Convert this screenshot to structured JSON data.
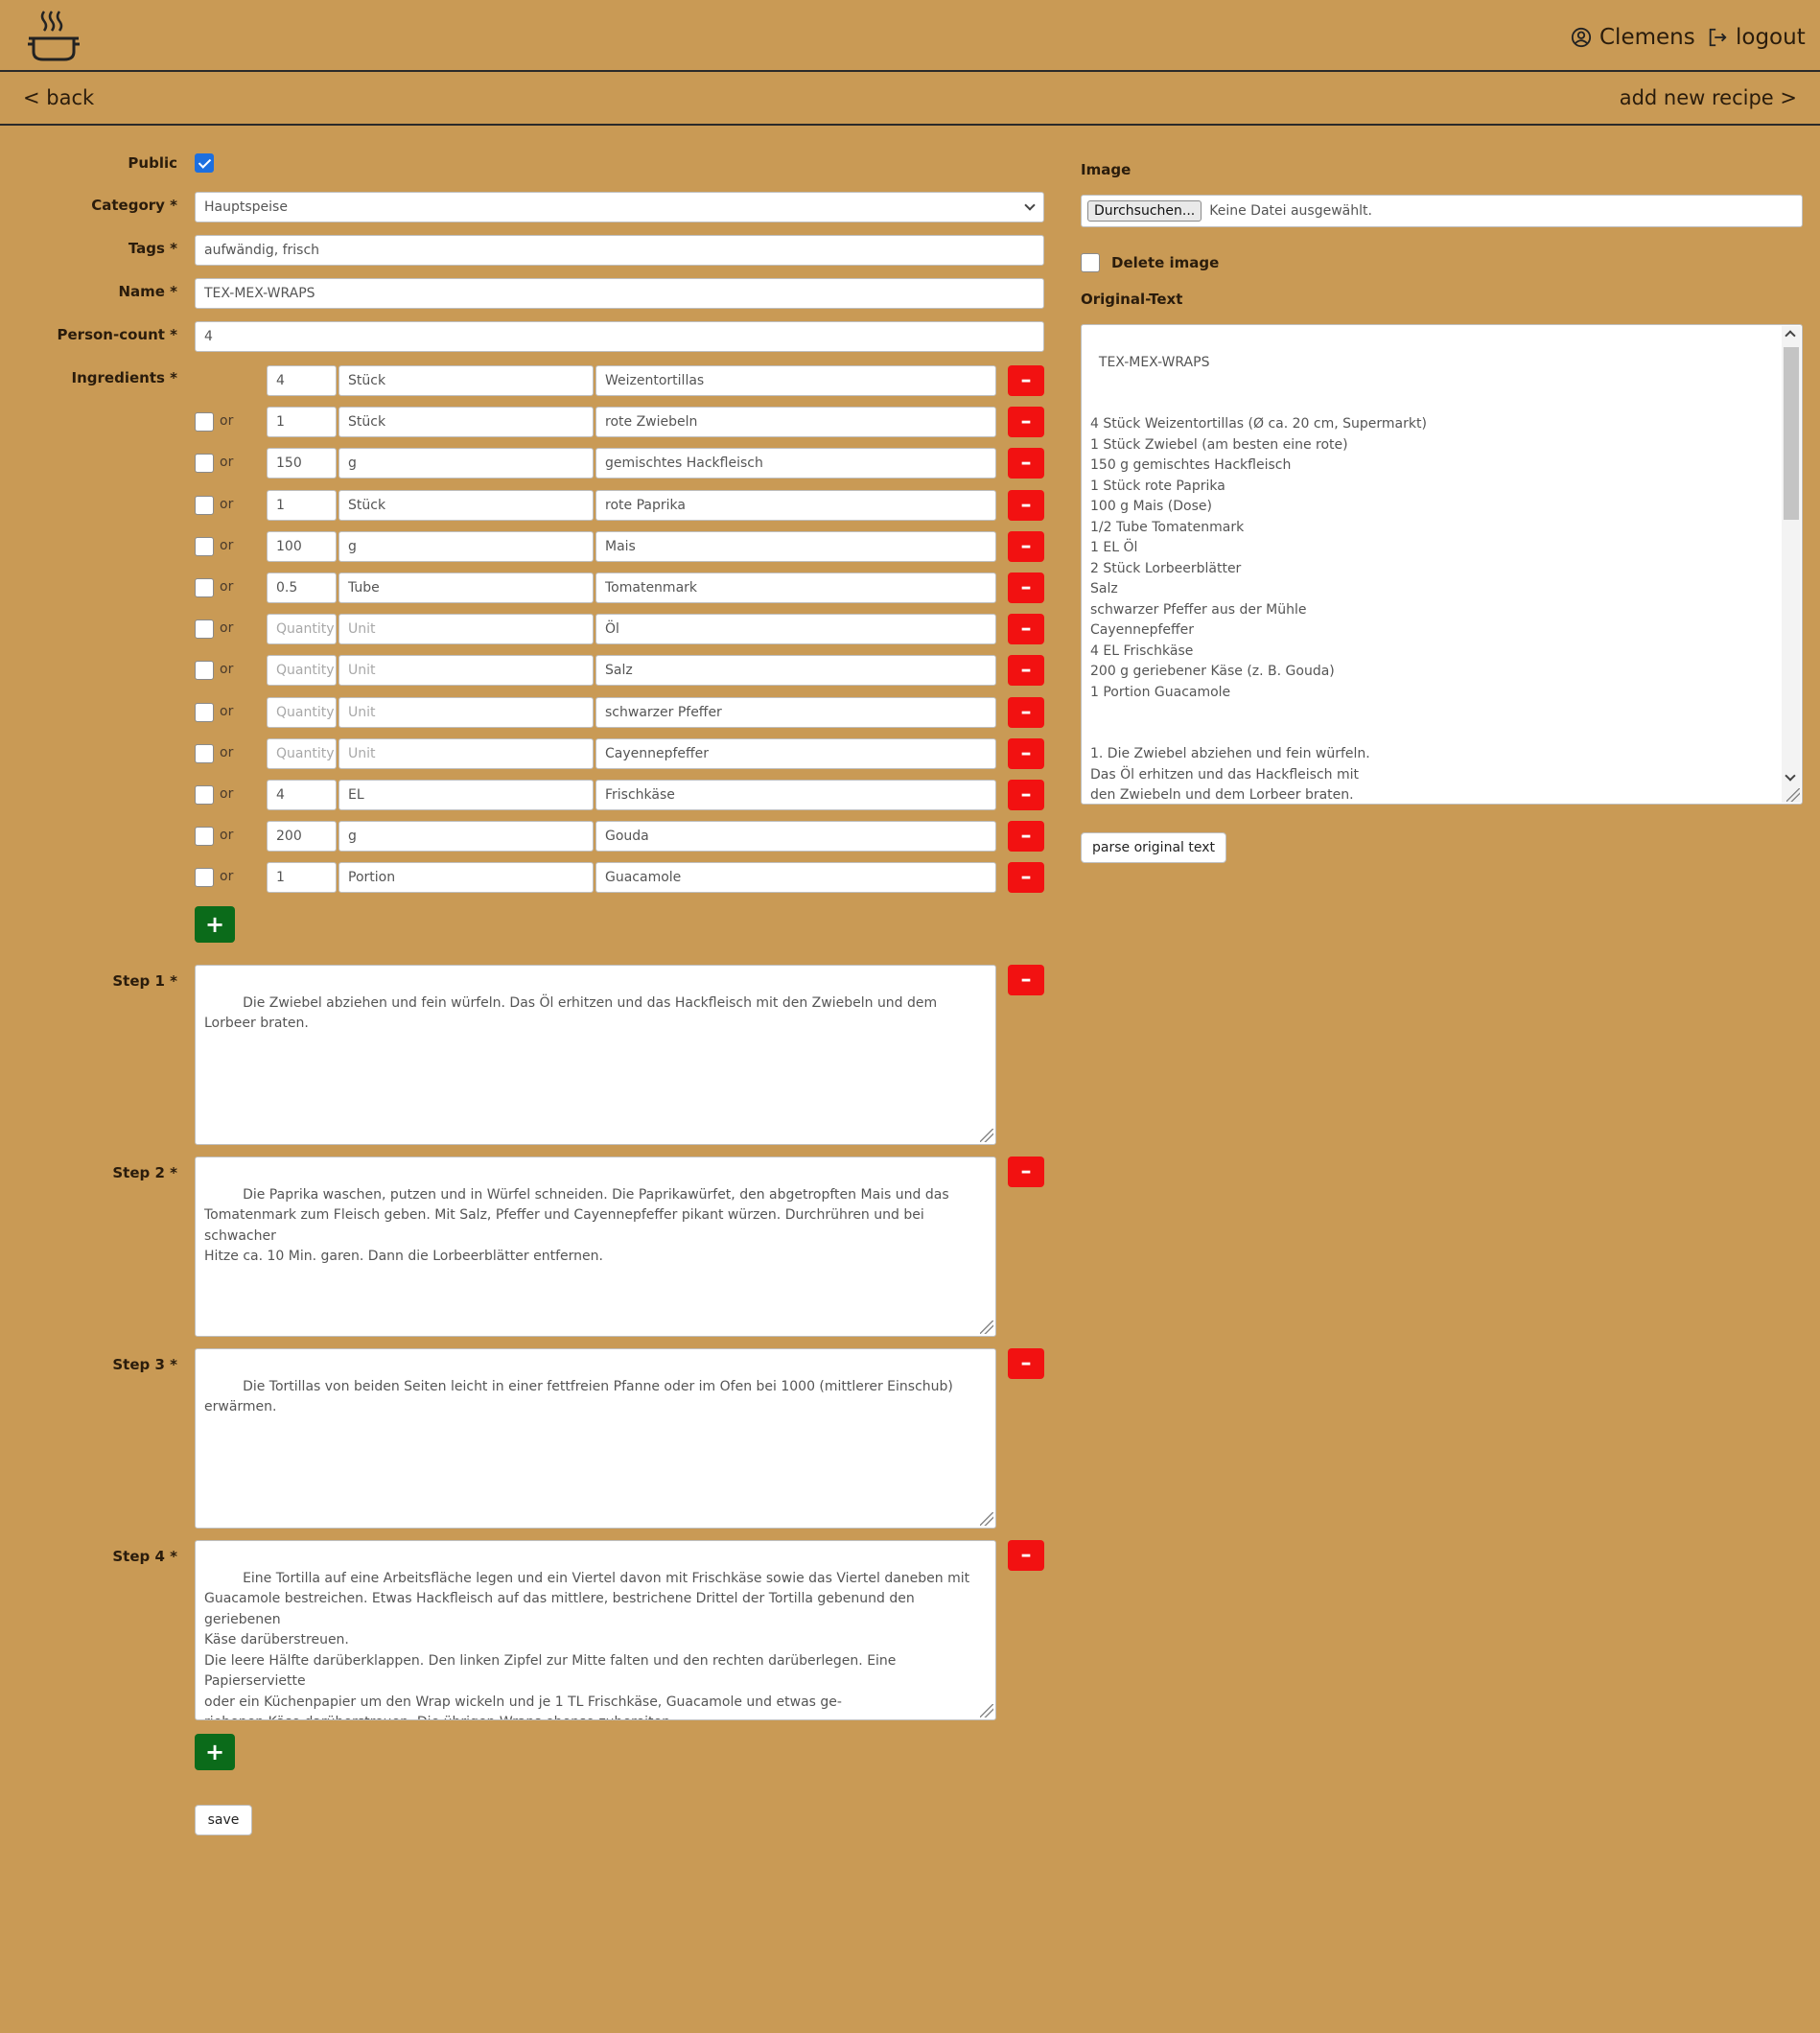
{
  "header": {
    "logo_icon": "cooking-pot-icon",
    "user_name": "Clemens",
    "logout_label": "logout"
  },
  "nav": {
    "back_label": "< back",
    "add_label": "add new recipe >"
  },
  "form": {
    "public_label": "Public",
    "public_checked": true,
    "category_label": "Category *",
    "category_value": "Hauptspeise",
    "tags_label": "Tags *",
    "tags_value": "aufwändig, frisch",
    "name_label": "Name *",
    "name_value": "TEX-MEX-WRAPS",
    "person_count_label": "Person-count *",
    "person_count_value": "4",
    "ingredients_label": "Ingredients *",
    "or_label": "or",
    "quantity_placeholder": "Quantity",
    "unit_placeholder": "Unit",
    "ingredients": [
      {
        "quantity": "4",
        "unit": "Stück",
        "name": "Weizentortillas"
      },
      {
        "quantity": "1",
        "unit": "Stück",
        "name": "rote Zwiebeln"
      },
      {
        "quantity": "150",
        "unit": "g",
        "name": "gemischtes Hackfleisch"
      },
      {
        "quantity": "1",
        "unit": "Stück",
        "name": "rote Paprika"
      },
      {
        "quantity": "100",
        "unit": "g",
        "name": "Mais"
      },
      {
        "quantity": "0.5",
        "unit": "Tube",
        "name": "Tomatenmark"
      },
      {
        "quantity": "",
        "unit": "",
        "name": "Öl"
      },
      {
        "quantity": "",
        "unit": "",
        "name": "Salz"
      },
      {
        "quantity": "",
        "unit": "",
        "name": "schwarzer Pfeffer"
      },
      {
        "quantity": "",
        "unit": "",
        "name": "Cayennepfeffer"
      },
      {
        "quantity": "4",
        "unit": "EL",
        "name": "Frischkäse"
      },
      {
        "quantity": "200",
        "unit": "g",
        "name": "Gouda"
      },
      {
        "quantity": "1",
        "unit": "Portion",
        "name": "Guacamole"
      }
    ],
    "steps": [
      {
        "label": "Step 1 *",
        "text": "Die Zwiebel abziehen und fein würfeln. Das Öl erhitzen und das Hackfleisch mit den Zwiebeln und dem Lorbeer braten."
      },
      {
        "label": "Step 2 *",
        "text": "Die Paprika waschen, putzen und in Würfel schneiden. Die Paprikawürfet, den abgetropften Mais und das\nTomatenmark zum Fleisch geben. Mit Salz, Pfeffer und Cayennepfeffer pikant würzen. Durchrühren und bei schwacher\nHitze ca. 10 Min. garen. Dann die Lorbeerblätter entfernen."
      },
      {
        "label": "Step 3 *",
        "text": "Die Tortillas von beiden Seiten leicht in einer fettfreien Pfanne oder im Ofen bei 1000 (mittlerer Einschub) erwärmen."
      },
      {
        "label": "Step 4 *",
        "text": "Eine Tortilla auf eine Arbeitsfläche legen und ein Viertel davon mit Frischkäse sowie das Viertel daneben mit\nGuacamole bestreichen. Etwas Hackfleisch auf das mittlere, bestrichene Drittel der Tortilla gebenund den geriebenen\nKäse darüberstreuen.\nDie leere Hälfte darüberklappen. Den linken Zipfel zur Mitte falten und den rechten darüberlegen. Eine Papierserviette\noder ein Küchenpapier um den Wrap wickeln und je 1 TL Frischkäse, Guacamole und etwas ge-\nriebenen Käse darüberstreuen. Die übrigen Wraps ebenso zubereiten."
      }
    ],
    "save_label": "save"
  },
  "side": {
    "image_label": "Image",
    "browse_label": "Durchsuchen...",
    "no_file_label": "Keine Datei ausgewählt.",
    "delete_image_label": "Delete image",
    "delete_image_checked": false,
    "original_text_label": "Original-Text",
    "original_text": "TEX-MEX-WRAPS\n\n\n4 Stück Weizentortillas (Ø ca. 20 cm, Supermarkt)\n1 Stück Zwiebel (am besten eine rote)\n150 g gemischtes Hackfleisch\n1 Stück rote Paprika\n100 g Mais (Dose)\n1/2 Tube Tomatenmark\n1 EL Öl\n2 Stück Lorbeerblätter\nSalz\nschwarzer Pfeffer aus der Mühle\nCayennepfeffer\n4 EL Frischkäse\n200 g geriebener Käse (z. B. Gouda)\n1 Portion Guacamole\n\n\n1. Die Zwiebel abziehen und fein würfeln.\nDas Öl erhitzen und das Hackfleisch mit\nden Zwiebeln und dem Lorbeer braten.",
    "parse_label": "parse original text"
  },
  "colors": {
    "background": "#c99a55",
    "remove_button": "#f21111",
    "add_button": "#0b6b1a",
    "checkbox_checked": "#1c6fe0"
  }
}
